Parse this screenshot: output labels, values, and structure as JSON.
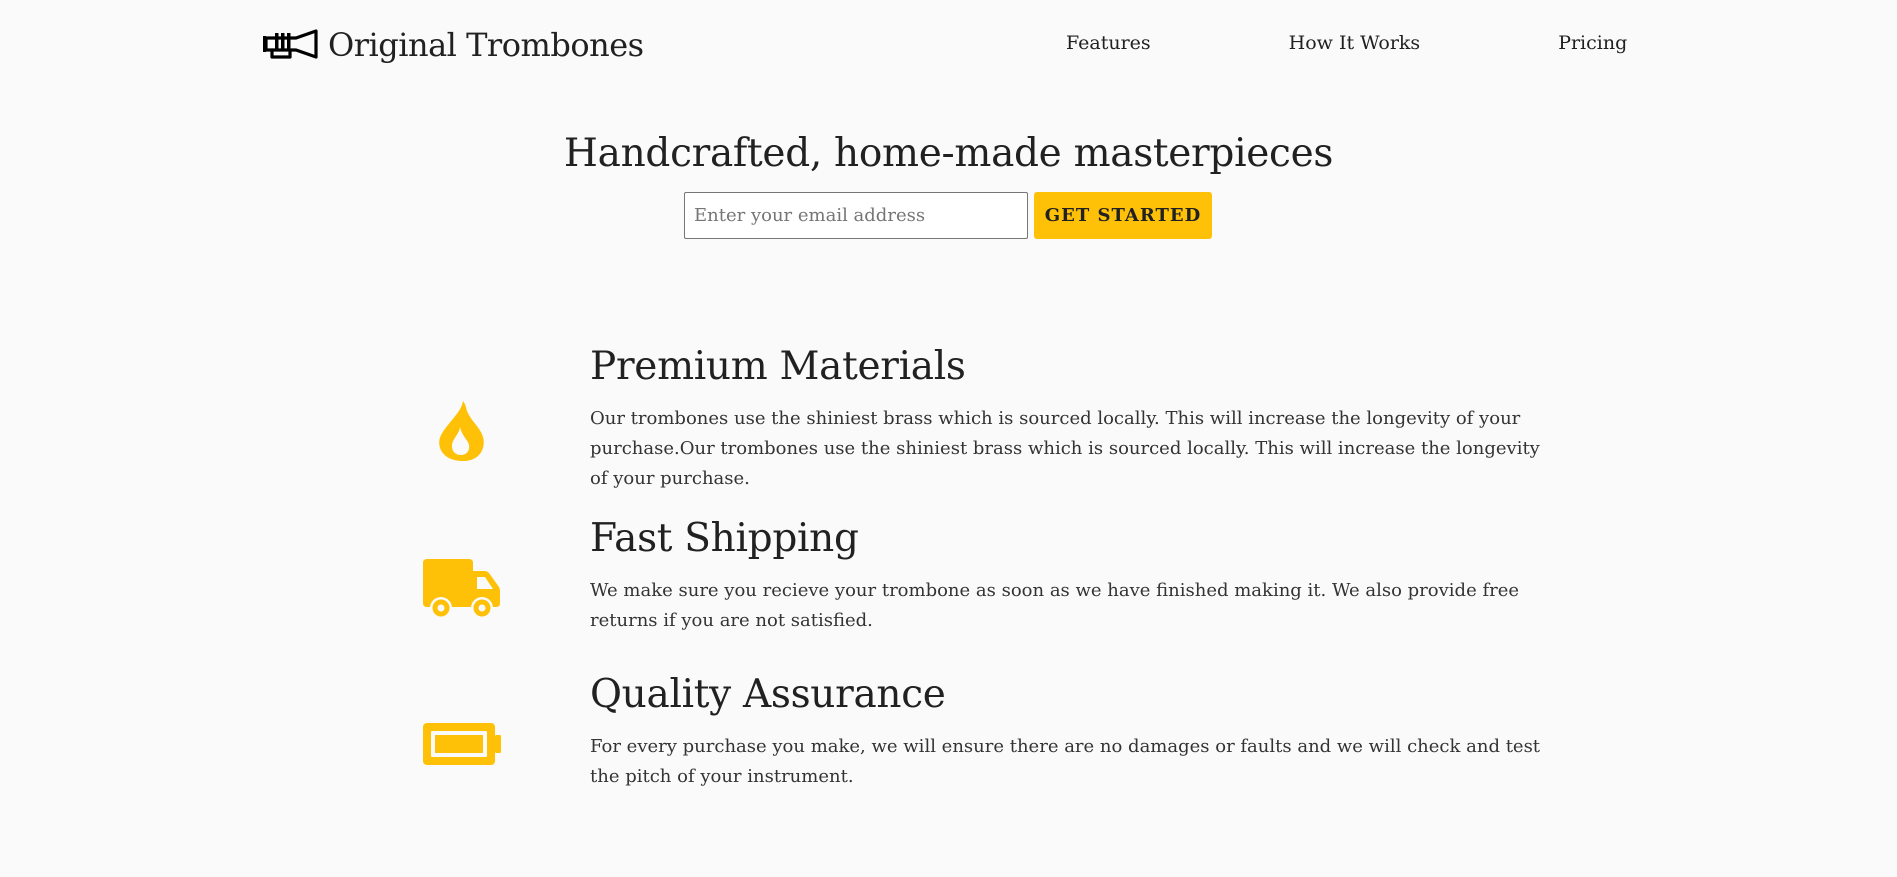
{
  "header": {
    "brand": "Original Trombones",
    "logo_icon": "trumpet-icon",
    "nav": [
      {
        "label": "Features"
      },
      {
        "label": "How It Works"
      },
      {
        "label": "Pricing"
      }
    ]
  },
  "hero": {
    "title": "Handcrafted, home-made masterpieces",
    "email_placeholder": "Enter your email address",
    "cta_label": "GET STARTED"
  },
  "features": [
    {
      "icon": "fire-icon",
      "title": "Premium Materials",
      "description": "Our trombones use the shiniest brass which is sourced locally. This will increase the longevity of your purchase.Our trombones use the shiniest brass which is sourced locally. This will increase the longevity of your purchase."
    },
    {
      "icon": "truck-icon",
      "title": "Fast Shipping",
      "description": "We make sure you recieve your trombone as soon as we have finished making it. We also provide free returns if you are not satisfied."
    },
    {
      "icon": "battery-full-icon",
      "title": "Quality Assurance",
      "description": "For every purchase you make, we will ensure there are no damages or faults and we will check and test the pitch of your instrument."
    }
  ],
  "colors": {
    "accent": "#ffc107",
    "text": "#212121",
    "background": "#fafafa"
  }
}
